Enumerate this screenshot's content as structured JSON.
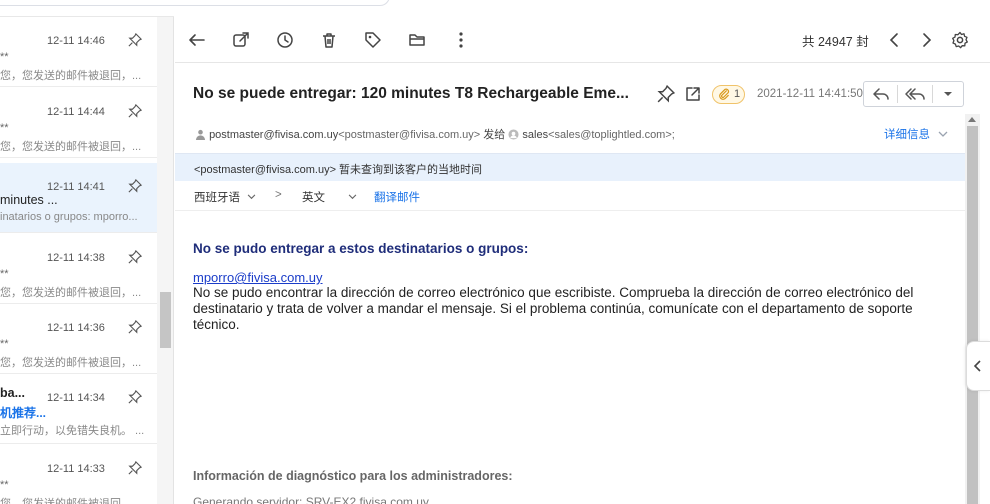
{
  "list": {
    "items": [
      {
        "time": "12-11 14:46",
        "sender": "**",
        "preview": "您，您发送的邮件被退回，..."
      },
      {
        "time": "12-11 14:44",
        "sender": "**",
        "preview": "您，您发送的邮件被退回，..."
      },
      {
        "time": "12-11 14:41",
        "subject": "minutes ...",
        "preview": "inatarios o grupos: mporro..."
      },
      {
        "time": "12-11 14:38",
        "sender": "**",
        "preview": "您，您发送的邮件被退回，..."
      },
      {
        "time": "12-11 14:36",
        "sender": "**",
        "preview": "您，您发送的邮件被退回，..."
      },
      {
        "time": "12-11 14:34",
        "sender": "ba...",
        "subject": "机推荐...",
        "preview": "立即行动，以免错失良机。 ..."
      },
      {
        "time": "12-11 14:33",
        "sender": "**",
        "preview": "您，您发送的邮件被退回，..."
      }
    ]
  },
  "toolbar": {
    "count": "共 24947 封",
    "icons": [
      "back-arrow-icon",
      "open-new-window-icon",
      "clock-icon",
      "trash-icon",
      "tag-icon",
      "folder-icon",
      "more-vertical-icon",
      "prev-chevron-icon",
      "next-chevron-icon",
      "settings-gear-icon"
    ]
  },
  "message": {
    "subject": "No se puede entregar: 120 minutes T8 Rechargeable Eme...",
    "attachment_count": "1",
    "datetime": "2021-12-11 14:41:50",
    "from": "postmaster@fivisa.com.uy",
    "from_full": "<postmaster@fivisa.com.uy>",
    "sent_to_label": "发给",
    "to_name": "sales",
    "to_full": "<sales@toplightled.com>;",
    "details_label": "详细信息",
    "notice": "<postmaster@fivisa.com.uy> 暂未查询到该客户的当地时间",
    "translate": {
      "source_lang": "西班牙语",
      "arrow": ">",
      "target_lang": "英文",
      "action": "翻译邮件"
    },
    "body_title": "No se pudo entregar a estos destinatarios o grupos:",
    "body_email": "mporro@fivisa.com.uy",
    "body_text": "No se pudo encontrar la dirección de correo electrónico que escribiste. Comprueba la dirección de correo electrónico del destinatario y trata de volver a mandar el mensaje. Si el problema continúa, comunícate con el departamento de soporte técnico.",
    "diag_title": "Información de diagnóstico para los administradores:",
    "diag_server": "Generando servidor: SRV-EX2.fivisa.com.uy"
  },
  "colors": {
    "accent": "#1a73e8",
    "selected_row": "#eaf3fd",
    "notice_bg": "#e8f1fc",
    "body_title": "#1f2d7a"
  }
}
